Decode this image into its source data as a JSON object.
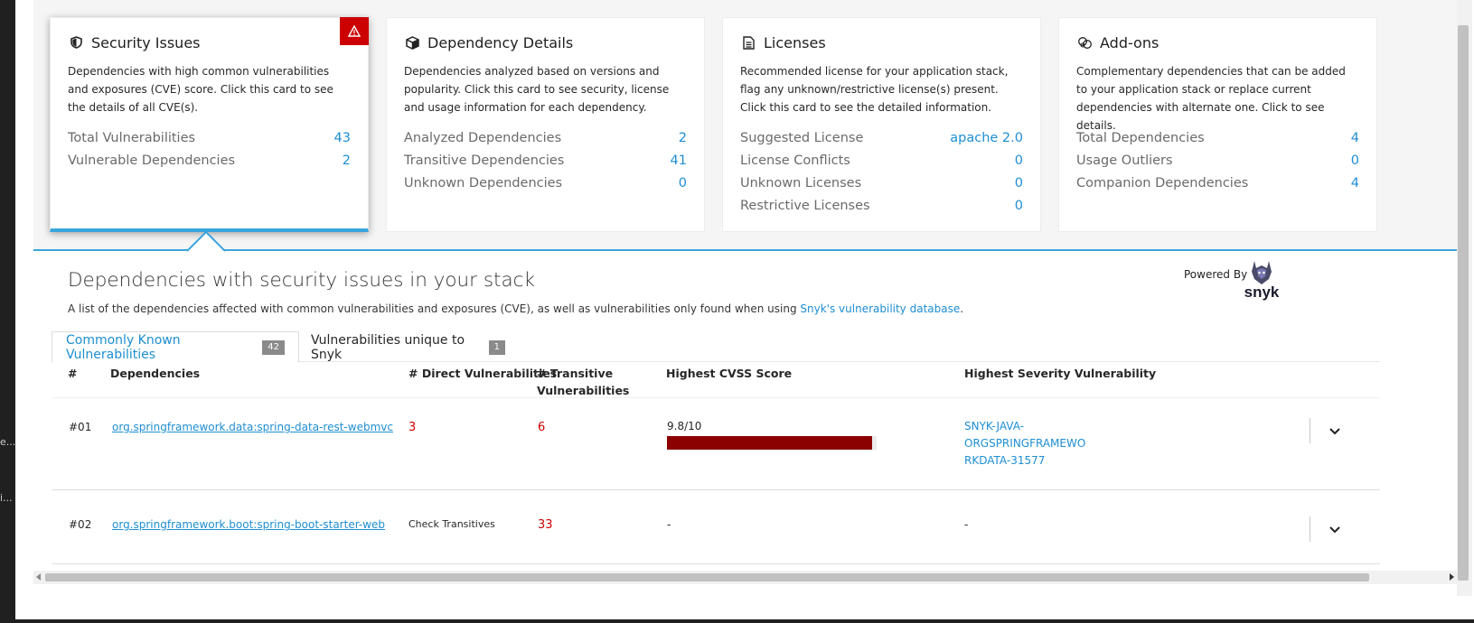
{
  "left_strip": {
    "snippet_1": "e...",
    "snippet_2": "i..."
  },
  "cards": [
    {
      "title": "Security Issues",
      "icon": "shield-icon",
      "description": "Dependencies with high common vulnerabilities and exposures (CVE) score. Click this card to see the details of all CVE(s).",
      "metrics": [
        {
          "label": "Total Vulnerabilities",
          "value": "43"
        },
        {
          "label": "Vulnerable Dependencies",
          "value": "2"
        }
      ],
      "alert_icon": "warning-triangle-icon"
    },
    {
      "title": "Dependency Details",
      "icon": "cube-icon",
      "description": "Dependencies analyzed based on versions and popularity. Click this card to see security, license and usage information for each dependency.",
      "metrics": [
        {
          "label": "Analyzed Dependencies",
          "value": "2"
        },
        {
          "label": "Transitive Dependencies",
          "value": "41"
        },
        {
          "label": "Unknown Dependencies",
          "value": "0"
        }
      ]
    },
    {
      "title": "Licenses",
      "icon": "document-icon",
      "description": "Recommended license for your application stack, flag any unknown/restrictive license(s) present. Click this card to see the detailed information.",
      "metrics": [
        {
          "label": "Suggested License",
          "value": "apache 2.0"
        },
        {
          "label": "License Conflicts",
          "value": "0"
        },
        {
          "label": "Unknown Licenses",
          "value": "0"
        },
        {
          "label": "Restrictive Licenses",
          "value": "0"
        }
      ]
    },
    {
      "title": "Add-ons",
      "icon": "cubes-icon",
      "description": "Complementary dependencies that can be added to your application stack or replace current dependencies with alternate one. Click to see details.",
      "metrics": [
        {
          "label": "Total Dependencies",
          "value": "4"
        },
        {
          "label": "Usage Outliers",
          "value": "0"
        },
        {
          "label": "Companion Dependencies",
          "value": "4"
        }
      ]
    }
  ],
  "section": {
    "title": "Dependencies with security issues in your stack",
    "description_prefix": "A list of the dependencies affected with common vulnerabilities and exposures (CVE), as well as vulnerabilities only found when using ",
    "description_link": "Snyk's vulnerability database",
    "description_suffix": ".",
    "powered_by": "Powered By",
    "logo_text": "snyk"
  },
  "tabs": [
    {
      "label": "Commonly Known Vulnerabilities",
      "count": "42"
    },
    {
      "label": "Vulnerabilities unique to Snyk",
      "count": "1"
    }
  ],
  "table": {
    "headers": {
      "num": "#",
      "dependencies": "Dependencies",
      "direct": "# Direct Vulnerabilities",
      "transitive_1": "# Transitive",
      "transitive_2": "Vulnerabilities",
      "cvss": "Highest CVSS Score",
      "severity": "Highest Severity Vulnerability"
    },
    "rows": [
      {
        "num": "#01",
        "dependency": "org.springframework.data:spring-data-rest-webmvc",
        "direct": "3",
        "transitive": "6",
        "cvss_text": "9.8/10",
        "cvss_fraction": 0.98,
        "severity_lines": [
          "SNYK-JAVA-",
          "ORGSPRINGFRAMEWO",
          "RKDATA-31577"
        ]
      },
      {
        "num": "#02",
        "dependency": "org.springframework.boot:spring-boot-starter-web",
        "direct": "Check Transitives",
        "transitive": "33",
        "cvss_text": "-",
        "severity_text": "-"
      }
    ]
  },
  "colors": {
    "accent": "#1e8ed2",
    "danger": "#cc0000",
    "cvss_bar": "#8b0000",
    "band": "#f5f5f5"
  }
}
